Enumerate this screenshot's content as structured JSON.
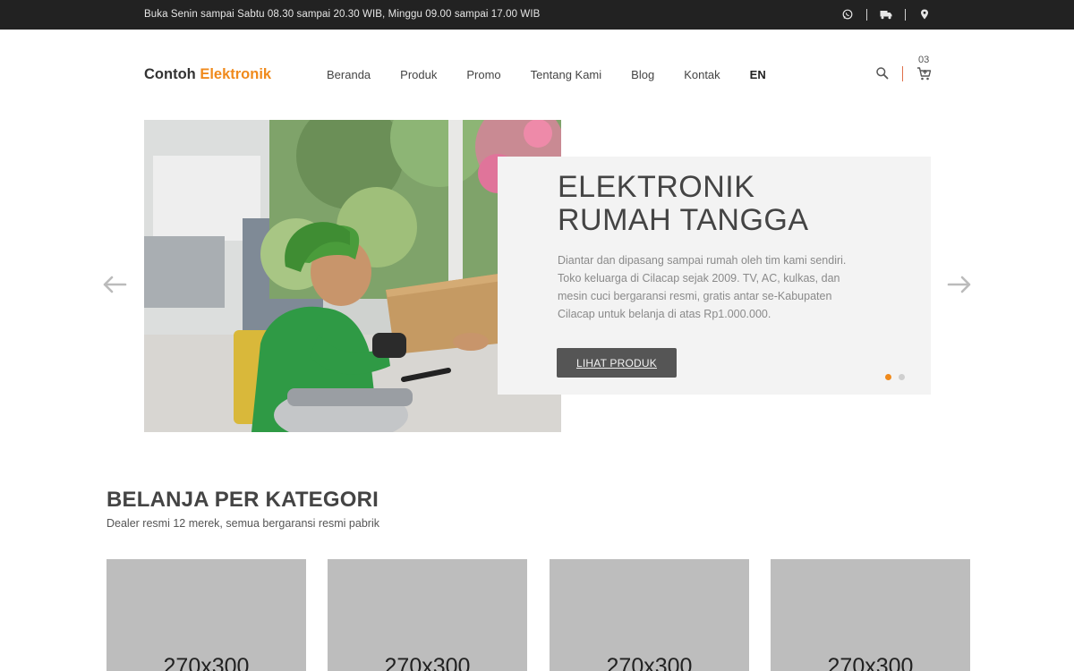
{
  "topbar": {
    "hours": "Buka Senin sampai Sabtu 08.30 sampai 20.30 WIB, Minggu 09.00 sampai 17.00 WIB",
    "icons": [
      "whatsapp-icon",
      "truck-icon",
      "location-pin-icon"
    ]
  },
  "header": {
    "logo_main": "Contoh",
    "logo_accent": "Elektronik",
    "accent_color": "#f08a1c",
    "nav": [
      "Beranda",
      "Produk",
      "Promo",
      "Tentang Kami",
      "Blog",
      "Kontak"
    ],
    "language": "EN",
    "cart_count": "03"
  },
  "hero": {
    "title_line1": "ELEKTRONIK",
    "title_line2": "RUMAH TANGGA",
    "description": "Diantar dan dipasang sampai rumah oleh tim kami sendiri. Toko keluarga di Cilacap sejak 2009. TV, AC, kulkas, dan mesin cuci bergaransi resmi, gratis antar se-Kabupaten Cilacap untuk belanja di atas Rp1.000.000.",
    "button": "LIHAT PRODUK",
    "slide_count": 2,
    "active_slide": 1
  },
  "categories": {
    "title": "BELANJA PER KATEGORI",
    "subtitle": "Dealer resmi 12 merek, semua bergaransi resmi pabrik",
    "placeholders": [
      "270x300",
      "270x300",
      "270x300",
      "270x300"
    ]
  }
}
